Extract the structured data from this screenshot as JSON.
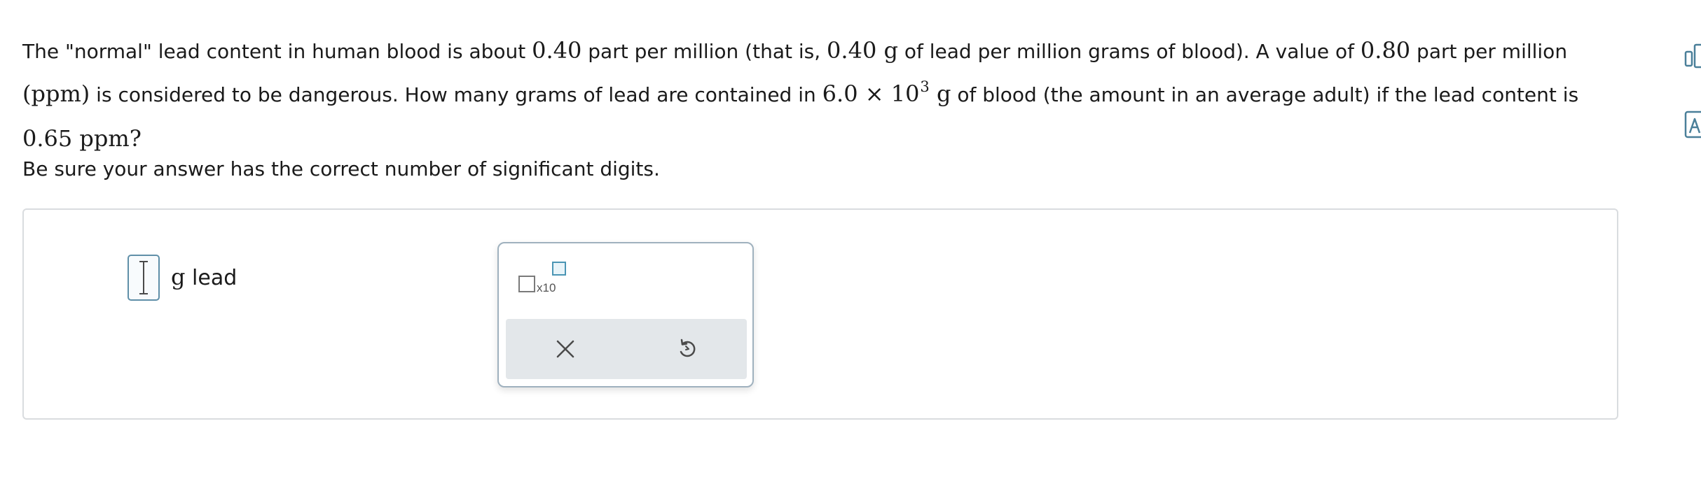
{
  "problem": {
    "p1": "The \"normal\" lead content in human blood is about ",
    "m1": "0.40",
    "p2": " part per million (that is, ",
    "m2": "0.40 g",
    "p3": " of lead per million grams of blood). A value of ",
    "m3": "0.80",
    "p4": " part per million",
    "m4": "(ppm)",
    "p5": " is considered to be dangerous. How many grams of lead are contained in ",
    "m5": "6.0 × 10",
    "m5_exp": "3",
    "m5_unit": " g",
    "p6": " of blood (the amount in an average adult) if the lead content is",
    "m6": "0.65 ppm?"
  },
  "instruction": "Be sure your answer has the correct number of significant digits.",
  "answer": {
    "value": "",
    "unit_g": "g",
    "unit_rest": " lead"
  },
  "palette": {
    "sci_notation_label": "x10",
    "sci_notation_icon": "scientific-notation-icon",
    "clear_icon": "close-x-icon",
    "undo_icon": "undo-icon"
  },
  "side_tools": {
    "calculator_icon": "calculator-icon",
    "reference_icon": "periodic-table-icon"
  },
  "colors": {
    "input_border": "#5f8fa8",
    "accent_teal": "#4a95b4",
    "panel_border": "#d9dcdf",
    "action_bar": "#e3e7ea",
    "icon_gray": "#4a4a4a"
  }
}
